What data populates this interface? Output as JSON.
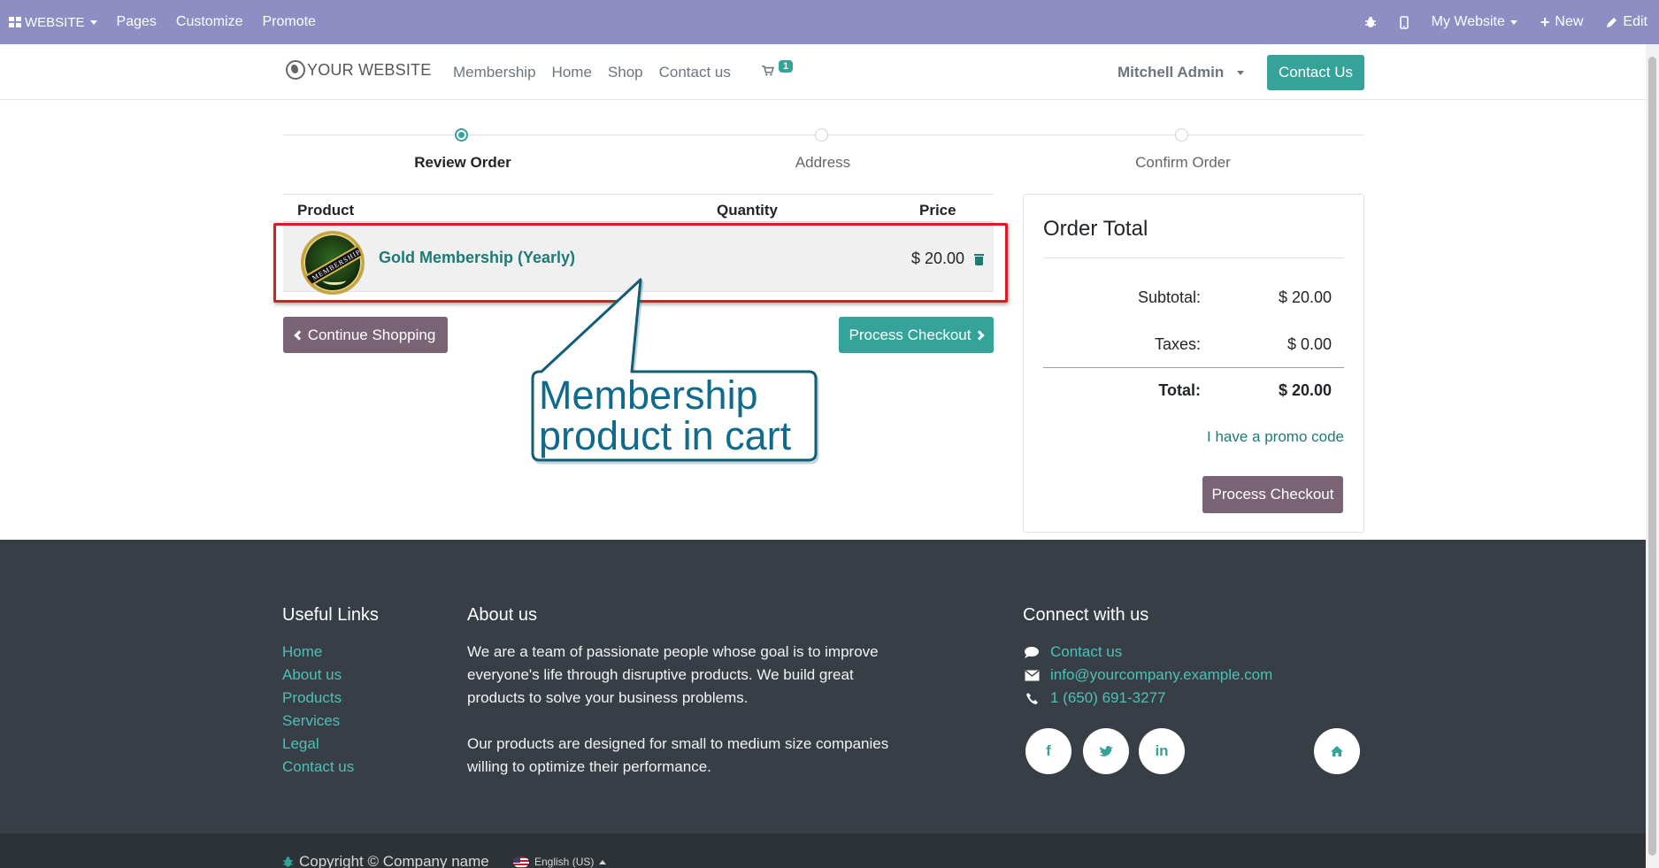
{
  "admin_bar": {
    "brand": "WEBSITE",
    "menu": [
      "Pages",
      "Customize",
      "Promote"
    ],
    "right": {
      "website": "My Website",
      "new": "New",
      "edit": "Edit"
    }
  },
  "header": {
    "logo": "YOUR WEBSITE",
    "nav": [
      "Membership",
      "Home",
      "Shop",
      "Contact us"
    ],
    "cart_count": "1",
    "user": "Mitchell Admin",
    "contact_button": "Contact Us"
  },
  "wizard": {
    "steps": [
      {
        "label": "Review Order",
        "active": true
      },
      {
        "label": "Address",
        "active": false
      },
      {
        "label": "Confirm Order",
        "active": false
      }
    ]
  },
  "cart": {
    "columns": {
      "product": "Product",
      "quantity": "Quantity",
      "price": "Price"
    },
    "items": [
      {
        "image_text": "MEMBERSHIP",
        "name": "Gold Membership (Yearly)",
        "price": "$ 20.00"
      }
    ],
    "continue_label": "Continue Shopping",
    "checkout_label": "Process Checkout"
  },
  "callout": {
    "text": "Membership product in cart",
    "color": "#0f6a8c"
  },
  "order_total": {
    "title": "Order Total",
    "subtotal_label": "Subtotal:",
    "subtotal_value": "$ 20.00",
    "taxes_label": "Taxes:",
    "taxes_value": "$ 0.00",
    "total_label": "Total:",
    "total_value": "$ 20.00",
    "promo_link": "I have a promo code",
    "checkout_label": "Process Checkout"
  },
  "footer": {
    "useful_links": {
      "title": "Useful Links",
      "items": [
        "Home",
        "About us",
        "Products",
        "Services",
        "Legal",
        "Contact us"
      ]
    },
    "about": {
      "title": "About us",
      "p1": "We are a team of passionate people whose goal is to improve everyone's life through disruptive products. We build great products to solve your business problems.",
      "p2": "Our products are designed for small to medium size companies willing to optimize their performance."
    },
    "connect": {
      "title": "Connect with us",
      "contact": "Contact us",
      "email": "info@yourcompany.example.com",
      "phone": "1 (650) 691-3277",
      "social": {
        "facebook": "f",
        "twitter": "t",
        "linkedin": "in"
      }
    },
    "copyright": "Copyright © Company name",
    "language": "English (US)"
  },
  "colors": {
    "admin_bar": "#8f8ec4",
    "primary": "#36a39b",
    "secondary": "#7b6376",
    "highlight": "#d81e24",
    "footer": "#383e45"
  }
}
